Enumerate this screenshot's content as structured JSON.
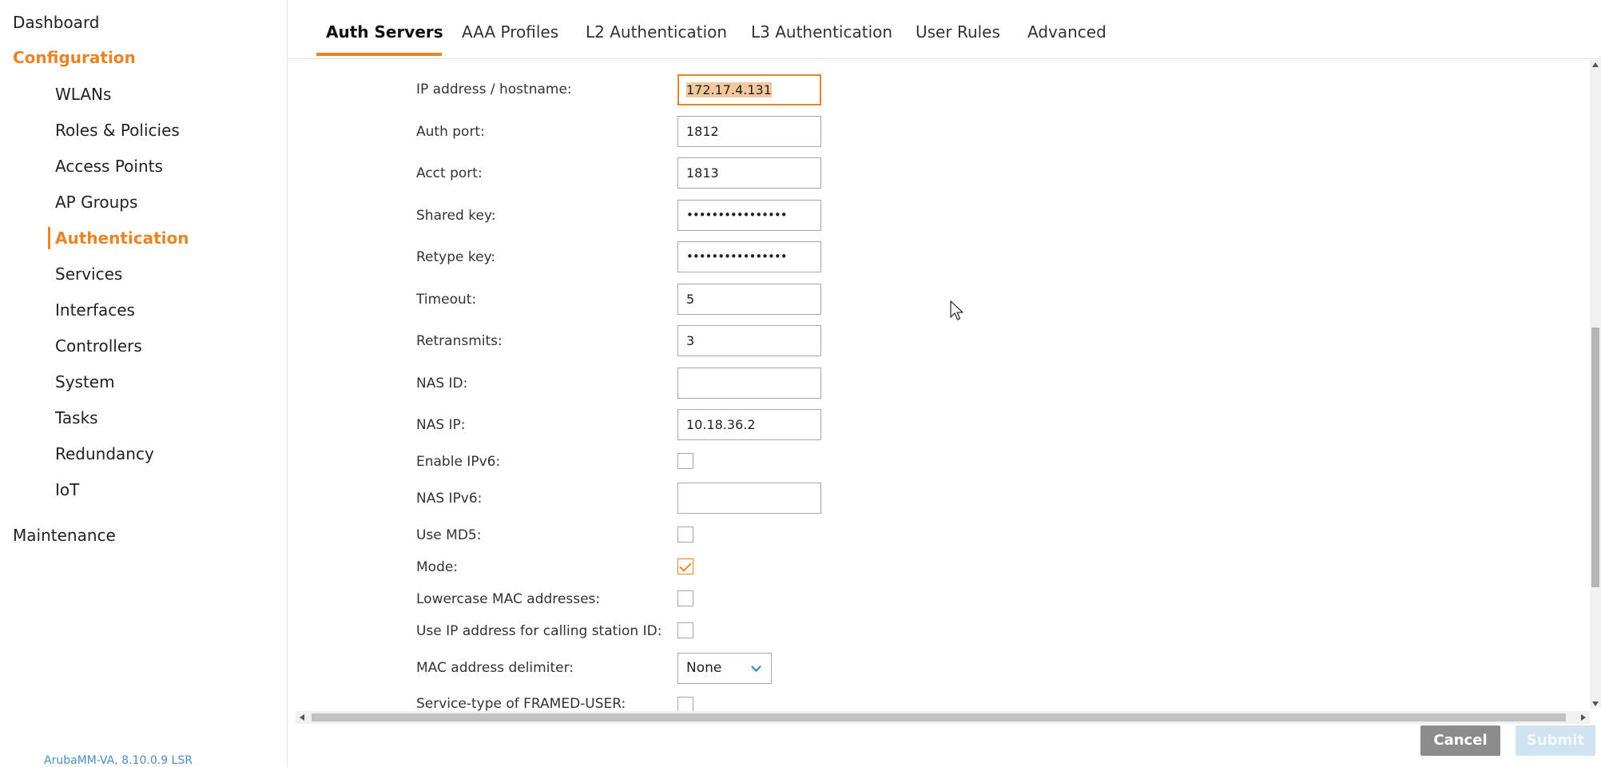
{
  "sidebar": {
    "dashboard": "Dashboard",
    "configuration": "Configuration",
    "items": [
      {
        "label": "WLANs"
      },
      {
        "label": "Roles & Policies"
      },
      {
        "label": "Access Points"
      },
      {
        "label": "AP Groups"
      },
      {
        "label": "Authentication"
      },
      {
        "label": "Services"
      },
      {
        "label": "Interfaces"
      },
      {
        "label": "Controllers"
      },
      {
        "label": "System"
      },
      {
        "label": "Tasks"
      },
      {
        "label": "Redundancy"
      },
      {
        "label": "IoT"
      }
    ],
    "maintenance": "Maintenance",
    "version": "ArubaMM-VA, 8.10.0.9 LSR"
  },
  "tabs": [
    {
      "label": "Auth Servers"
    },
    {
      "label": "AAA Profiles"
    },
    {
      "label": "L2 Authentication"
    },
    {
      "label": "L3 Authentication"
    },
    {
      "label": "User Rules"
    },
    {
      "label": "Advanced"
    }
  ],
  "form": {
    "ip_hostname": {
      "label": "IP address / hostname:",
      "value": "172.17.4.131"
    },
    "auth_port": {
      "label": "Auth port:",
      "value": "1812"
    },
    "acct_port": {
      "label": "Acct port:",
      "value": "1813"
    },
    "shared_key": {
      "label": "Shared key:",
      "value": "••••••••••••••••"
    },
    "retype_key": {
      "label": "Retype key:",
      "value": "••••••••••••••••"
    },
    "timeout": {
      "label": "Timeout:",
      "value": "5"
    },
    "retransmits": {
      "label": "Retransmits:",
      "value": "3"
    },
    "nas_id": {
      "label": "NAS ID:",
      "value": ""
    },
    "nas_ip": {
      "label": "NAS IP:",
      "value": "10.18.36.2"
    },
    "enable_ipv6": {
      "label": "Enable IPv6:",
      "checked": false
    },
    "nas_ipv6": {
      "label": "NAS IPv6:",
      "value": ""
    },
    "use_md5": {
      "label": "Use MD5:",
      "checked": false
    },
    "mode": {
      "label": "Mode:",
      "checked": true
    },
    "lowercase_mac": {
      "label": "Lowercase MAC addresses:",
      "checked": false
    },
    "use_ip_calling": {
      "label": "Use IP address for calling station ID:",
      "checked": false
    },
    "mac_delimiter": {
      "label": "MAC address delimiter:",
      "value": "None"
    },
    "service_type": {
      "label": "Service-type of FRAMED-USER:",
      "checked": false
    }
  },
  "buttons": {
    "cancel": "Cancel",
    "submit": "Submit"
  },
  "colors": {
    "accent": "#e98524",
    "link": "#4a8ec2",
    "cancel_bg": "#8c8c8c",
    "submit_bg_disabled": "#cfe3f0"
  }
}
